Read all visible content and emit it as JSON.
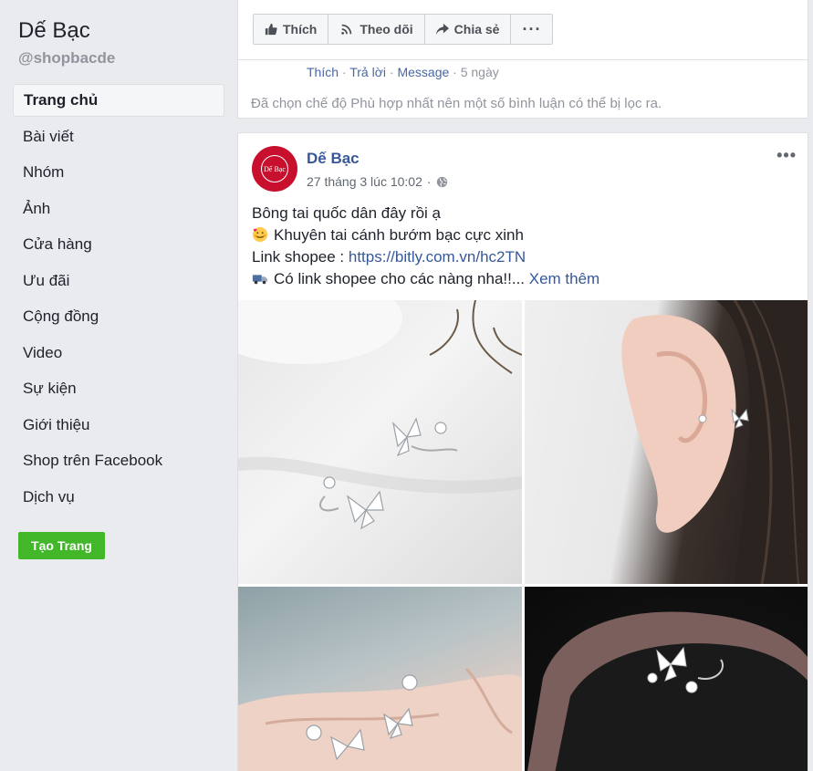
{
  "sidebar": {
    "page_name": "Dế Bạc",
    "handle": "@shopbacde",
    "items": [
      {
        "label": "Trang chủ",
        "active": true
      },
      {
        "label": "Bài viết"
      },
      {
        "label": "Nhóm"
      },
      {
        "label": "Ảnh"
      },
      {
        "label": "Cửa hàng"
      },
      {
        "label": "Ưu đãi"
      },
      {
        "label": "Cộng đồng"
      },
      {
        "label": "Video"
      },
      {
        "label": "Sự kiện"
      },
      {
        "label": "Giới thiệu"
      },
      {
        "label": "Shop trên Facebook"
      },
      {
        "label": "Dịch vụ"
      }
    ],
    "create_page": "Tạo Trang"
  },
  "top_card": {
    "actions": {
      "like": "Thích",
      "follow": "Theo dõi",
      "share": "Chia sẻ",
      "more": "···"
    },
    "comment_meta": {
      "like": "Thích",
      "reply": "Trả lời",
      "message": "Message",
      "sep": " · ",
      "time": "5 ngày"
    },
    "filter_note": "Đã chọn chế độ Phù hợp nhất nên một số bình luận có thể bị lọc ra."
  },
  "post": {
    "author": "Dế Bạc",
    "avatar_text": "Dế Bạc",
    "time": "27 tháng 3 lúc 10:02",
    "dot": "·",
    "more": "•••",
    "line1": "Bông tai quốc dân đây rồi ạ",
    "line2": "Khuyên tai cánh bướm bạc cực xinh",
    "line3_prefix": "Link shopee : ",
    "line3_link": "https://bitly.com.vn/hc2TN",
    "line4": "Có link shopee cho các nàng nha!!... ",
    "see_more": "Xem thêm"
  },
  "colors": {
    "link": "#365899",
    "create": "#42b72a"
  }
}
